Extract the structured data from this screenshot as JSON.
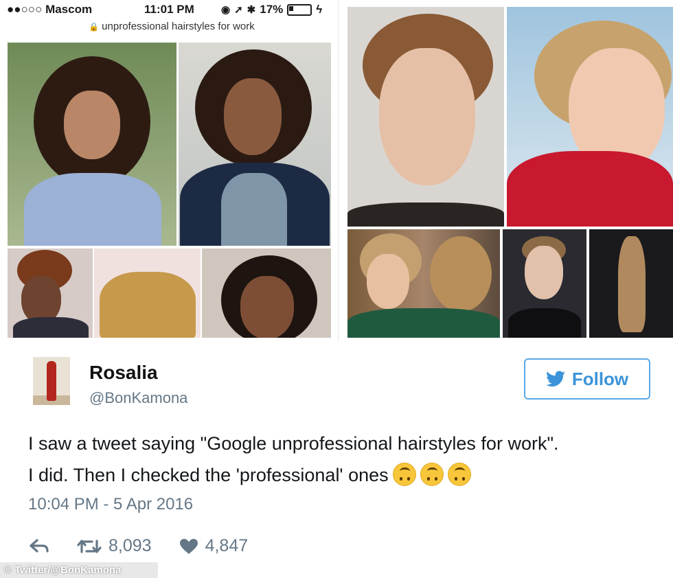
{
  "status_bar": {
    "carrier": "●●○○○ Mascom",
    "time": "11:01 PM",
    "battery": "17%"
  },
  "browser": {
    "url": "unprofessional hairstyles for work"
  },
  "tweet": {
    "display_name": "Rosalia",
    "handle": "@BonKamona",
    "follow_label": "Follow",
    "text_line1": "I saw a tweet saying \"Google unprofessional hairstyles for work\".",
    "text_line2": "I did. Then I checked the 'professional' ones",
    "timestamp": "10:04 PM - 5 Apr 2016",
    "retweets": "8,093",
    "likes": "4,847"
  },
  "credit": "© Twitter/@BonKamona",
  "colors": {
    "accent": "#3b94d9",
    "muted": "#657786"
  }
}
